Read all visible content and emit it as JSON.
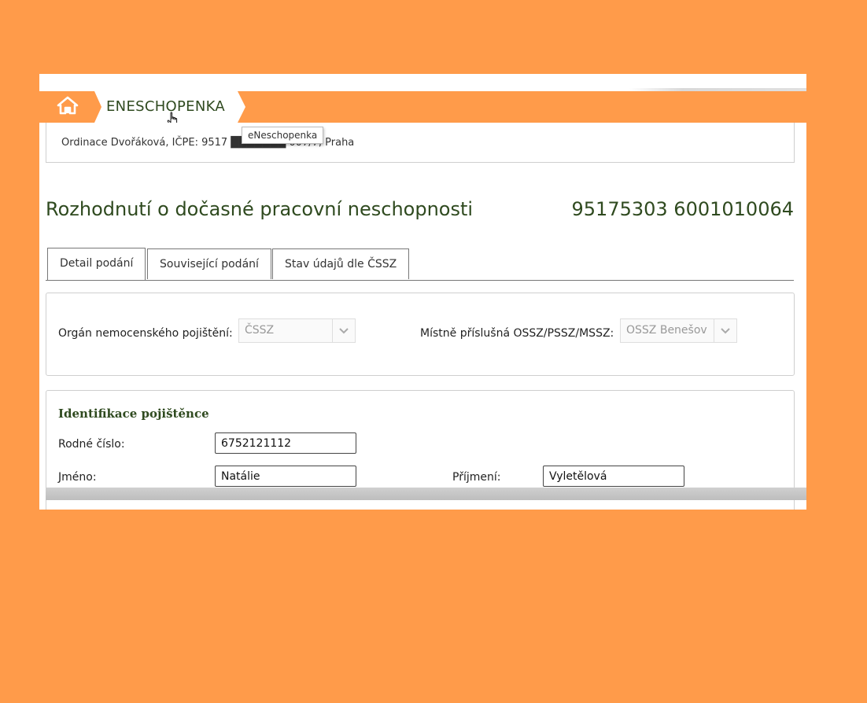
{
  "header": {
    "home_icon": "home-icon",
    "breadcrumb": "ENESCHOPENKA",
    "tooltip": "eNeschopenka",
    "info_text": "Ordinace Dvořáková, IČPE: 9517 ███████ 007/7, Praha"
  },
  "page": {
    "title": "Rozhodnutí o dočasné pracovní neschopnosti",
    "number": "95175303 6001010064"
  },
  "tabs": [
    {
      "label": "Detail podání",
      "active": true
    },
    {
      "label": "Související podání",
      "active": false
    },
    {
      "label": "Stav údajů dle ČSSZ",
      "active": false
    }
  ],
  "insurance": {
    "organ_label": "Orgán nemocenského pojištění:",
    "organ_value": "ČSSZ",
    "ossz_label": "Místně příslušná OSSZ/PSSZ/MSSZ:",
    "ossz_value": "OSSZ Benešov"
  },
  "insured": {
    "section_title": "Identifikace pojištěnce",
    "rc_label": "Rodné číslo:",
    "rc_value": "6752121112",
    "name_label": "Jméno:",
    "name_value": "Natálie",
    "surname_label": "Příjmení:",
    "surname_value": "Vyletělová"
  },
  "colors": {
    "background": "#FF9B4A",
    "accent_green": "#2f4a1f"
  }
}
